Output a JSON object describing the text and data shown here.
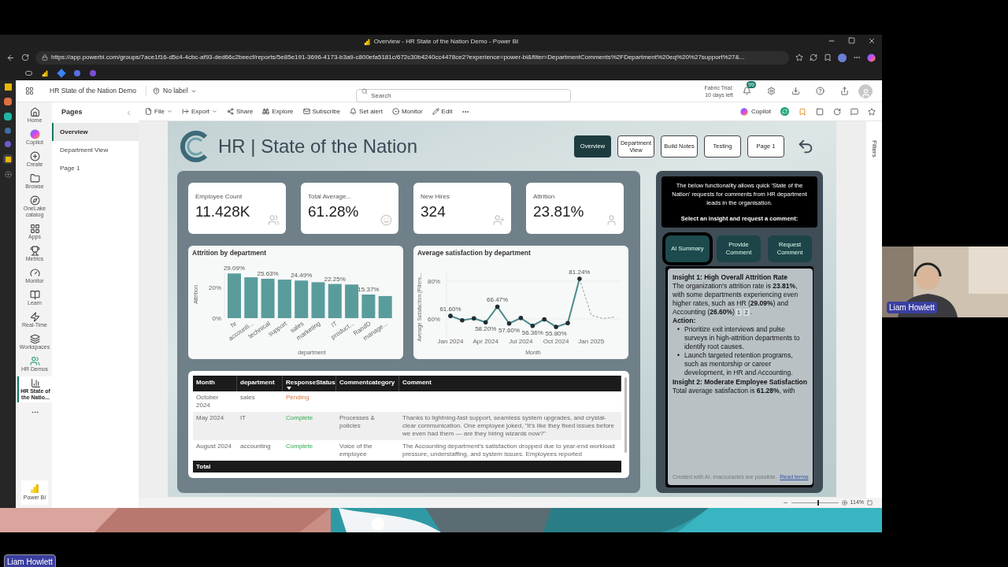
{
  "browser": {
    "title": "Overview - HR State of the Nation Demo - Power BI",
    "url": "https://app.powerbi.com/groups/7ace1f16-d5c4-4cbc-af93-ded66c2beecf/reports/5e85e191-3696-4173-b3a9-c800efa5181c/672c30b4240cc4478ce2?experience=power-bi&filter=DepartmentComments%2FDepartment%20eq%20%27support%27&..."
  },
  "app": {
    "workspace_title": "HR State of the Nation Demo",
    "sensitivity": "No label",
    "search": {
      "placeholder": "Search"
    },
    "trial": [
      "Fabric Trial:",
      "10 days left"
    ],
    "notification_count": "99"
  },
  "nav_rail": [
    {
      "label": "Home",
      "selected": false
    },
    {
      "label": "Copilot",
      "selected": false
    },
    {
      "label": "Create",
      "selected": false
    },
    {
      "label": "Browse",
      "selected": false
    },
    {
      "label": "OneLake catalog",
      "selected": false
    },
    {
      "label": "Apps",
      "selected": false
    },
    {
      "label": "Metrics",
      "selected": false
    },
    {
      "label": "Monitor",
      "selected": false
    },
    {
      "label": "Learn",
      "selected": false
    },
    {
      "label": "Real-Time",
      "selected": false
    },
    {
      "label": "Workspaces",
      "selected": false
    },
    {
      "label": "HR Demos",
      "selected": false
    },
    {
      "label": "HR State of the Natio...",
      "selected": true
    }
  ],
  "nav_footer": "Power BI",
  "pages": {
    "title": "Pages",
    "items": [
      {
        "label": "Overview",
        "selected": true
      },
      {
        "label": "Department View",
        "selected": false
      },
      {
        "label": "Page 1",
        "selected": false
      }
    ]
  },
  "toolbar": {
    "items": [
      {
        "label": "File",
        "dropdown": true
      },
      {
        "label": "Export",
        "dropdown": true
      },
      {
        "label": "Share",
        "dropdown": false
      },
      {
        "label": "Explore",
        "dropdown": false
      },
      {
        "label": "Subscribe",
        "dropdown": false
      },
      {
        "label": "Set alert",
        "dropdown": false
      },
      {
        "label": "Monitor",
        "dropdown": false
      },
      {
        "label": "Edit",
        "dropdown": false
      }
    ],
    "copilot": "Copilot"
  },
  "report": {
    "title": "HR | State of the Nation",
    "nav": [
      {
        "label": "Overview",
        "selected": true
      },
      {
        "label": "Department View",
        "selected": false
      },
      {
        "label": "Build Notes",
        "selected": false
      },
      {
        "label": "Testing",
        "selected": false
      },
      {
        "label": "Page 1",
        "selected": false
      }
    ],
    "kpis": [
      {
        "label": "Employee Count",
        "value": "11.428K"
      },
      {
        "label": "Total Average...",
        "value": "61.28%"
      },
      {
        "label": "New Hires",
        "value": "324"
      },
      {
        "label": "Attrition",
        "value": "23.81%"
      }
    ],
    "attrition_chart": {
      "title": "Attrition by department",
      "chart_data": {
        "type": "bar",
        "xlabel": "department",
        "ylabel": "Attrition",
        "categories": [
          "hr",
          "accounti...",
          "technical",
          "support",
          "sales",
          "marketing",
          "IT",
          "product...",
          "RandD",
          "manage..."
        ],
        "series": [
          {
            "color": "#5a9c9c",
            "values": [
              29.09,
              26.6,
              25.63,
              25.1,
              24.49,
              23.4,
              22.25,
              21.9,
              15.37,
              14.4
            ]
          }
        ],
        "ylim": [
          0,
          30
        ],
        "yticks": [
          {
            "value": 0,
            "label": "0%"
          },
          {
            "value": 20,
            "label": "20%"
          }
        ],
        "value_labels": [
          "29.09%",
          null,
          "25.63%",
          null,
          "24.49%",
          null,
          "22.25%",
          null,
          "15.37%",
          null
        ]
      }
    },
    "satisfaction_chart": {
      "title": "Average satisfaction by department",
      "chart_data": {
        "type": "line",
        "xlabel": "Month",
        "ylabel": "Average Satisfaction (Filtere...",
        "categories": [
          "Jan 2024",
          null,
          null,
          "Apr 2024",
          null,
          null,
          "Jul 2024",
          null,
          null,
          "Oct 2024",
          null,
          null,
          "Jan 2025",
          null,
          null
        ],
        "series": [
          {
            "color": "#4a8a8a",
            "line_style": "solid",
            "values": [
              61.6,
              59.3,
              60.3,
              58.2,
              66.47,
              57.6,
              60.5,
              56.36,
              59.8,
              55.8,
              57.8,
              81.24,
              null,
              null,
              null
            ]
          },
          {
            "color": "#9aa0a4",
            "line_style": "dashed",
            "values": [
              null,
              null,
              null,
              null,
              null,
              null,
              null,
              null,
              null,
              null,
              null,
              81.24,
              62,
              60.2,
              61
            ]
          }
        ],
        "ylim": [
          50,
          85
        ],
        "yticks": [
          {
            "value": 60,
            "label": "60%"
          },
          {
            "value": 80,
            "label": "80%"
          }
        ],
        "value_labels": [
          "61.60%",
          null,
          null,
          "58.20%",
          "66.47%",
          "57.60%",
          null,
          "56.36%",
          null,
          "55.80%",
          null,
          "81.24%",
          null,
          null,
          null
        ]
      }
    },
    "table": {
      "columns": [
        {
          "label": "Month",
          "sorted": false
        },
        {
          "label": "department",
          "sorted": false
        },
        {
          "label": "ResponseStatus",
          "sorted": true
        },
        {
          "label": "Commentcategory",
          "sorted": false
        },
        {
          "label": "Comment",
          "sorted": false
        }
      ],
      "rows": [
        {
          "cells": [
            "October 2024",
            "sales",
            "Pending",
            "",
            ""
          ],
          "complete": false
        },
        {
          "cells": [
            "May 2024",
            "IT",
            "Complete",
            "Processes & policies",
            "Thanks to lightning-fast support, seamless system upgrades, and crystal-clear communication. One employee joked, \"It's like they fixed issues before we even had them — are they hiring wizards now?\""
          ],
          "complete": true
        },
        {
          "cells": [
            "August 2024",
            "accounting",
            "Complete",
            "Voice of the employee",
            "The Accounting department's satisfaction dropped due to year-end workload pressure, understaffing, and system issues. Employees reported"
          ],
          "complete": true
        }
      ],
      "total": "Total"
    },
    "assistant": {
      "intro": "The below functionality allows quick 'State of the Nation' requests for comments from HR department leads in the organisation.",
      "prompt": "Select an insight and request a comment:",
      "tabs": [
        {
          "label": "AI Summary",
          "selected": true
        },
        {
          "label": "Provide Comment",
          "selected": false
        },
        {
          "label": "Request Comment",
          "selected": false
        }
      ],
      "content": [
        {
          "kind": "heading",
          "text": "Insight 1: High Overall Attrition Rate"
        },
        {
          "kind": "paragraph",
          "text": "The organization's attrition rate is **23.81%**, with some departments experiencing even higher rates, such as HR (**29.09%**) and Accounting (**26.60%**)",
          "citations": [
            "1",
            "2"
          ],
          "tail": "."
        },
        {
          "kind": "label",
          "text": "Action:"
        },
        {
          "kind": "bullets",
          "marker": "•",
          "items": [
            "Prioritize exit interviews and pulse surveys in high-attrition departments to identify root causes.",
            "Launch targeted retention programs, such as mentorship or career development, in HR and Accounting."
          ]
        },
        {
          "kind": "heading",
          "text": "Insight 2: Moderate Employee Satisfaction"
        },
        {
          "kind": "paragraph",
          "text": "Total average satisfaction is **61.28%**, with"
        }
      ],
      "disclaimer": "Created with AI. Inaccuracies are possible.",
      "terms_link": "Read terms"
    }
  },
  "filters_pane": {
    "label": "Filters"
  },
  "status_bar": {
    "zoom": "114%",
    "level": 0.55
  },
  "webcam": {
    "name": "Liam Howlett"
  },
  "presenter_badge": "Liam Howlett"
}
